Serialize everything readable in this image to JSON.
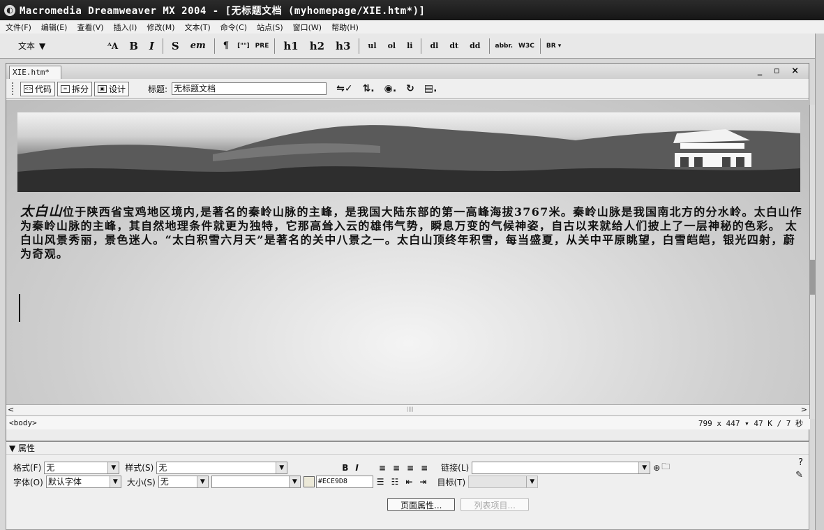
{
  "title_bar": {
    "text": "Macromedia Dreamweaver MX 2004 - [无标题文档 (myhomepage/XIE.htm*)]"
  },
  "menu": [
    "文件(F)",
    "编辑(E)",
    "查看(V)",
    "插入(I)",
    "修改(M)",
    "文本(T)",
    "命令(C)",
    "站点(S)",
    "窗口(W)",
    "帮助(H)"
  ],
  "toolbar": {
    "category": "文本",
    "buttons": [
      "B",
      "I",
      "S",
      "em",
      "¶",
      "[\"\"]",
      "PRE",
      "h1",
      "h2",
      "h3",
      "ul",
      "ol",
      "li",
      "dl",
      "dt",
      "dd",
      "abbr.",
      "W3C"
    ]
  },
  "document": {
    "tab": "XIE.htm*",
    "views": {
      "code": "代码",
      "split": "拆分",
      "design": "设计"
    },
    "title_label": "标题:",
    "title_value": "无标题文档",
    "lead": "太白山",
    "paragraph": "位于陕西省宝鸡地区境内,是著名的秦岭山脉的主峰，是我国大陆东部的第一高峰海拔3767米。秦岭山脉是我国南北方的分水岭。太白山作为秦岭山脉的主峰，其自然地理条件就更为独特，它那高耸入云的雄伟气势，瞬息万变的气候神姿，自古以来就给人们披上了一层神秘的色彩。 太白山风景秀丽，景色迷人。“太白积雪六月天”是著名的关中八景之一。太白山顶终年积雪，每当盛夏，从关中平原眺望，白雪皑皑，银光四射，蔚为奇观。",
    "tag": "<body>",
    "status_info": "799 x 447 ▾ 47 K / 7 秒"
  },
  "properties": {
    "header": "属性",
    "format_label": "格式(F)",
    "format_value": "无",
    "style_label": "样式(S)",
    "style_value": "无",
    "font_label": "字体(O)",
    "font_value": "默认字体",
    "size_label": "大小(S)",
    "size_value": "无",
    "color_value": "#ECE9D8",
    "link_label": "链接(L)",
    "target_label": "目标(T)",
    "page_props": "页面属性...",
    "list_item": "列表项目..."
  },
  "colors": {
    "titlebar": "#1e1e1e",
    "canvas": "#d9d9d9",
    "panel": "#efefef"
  }
}
